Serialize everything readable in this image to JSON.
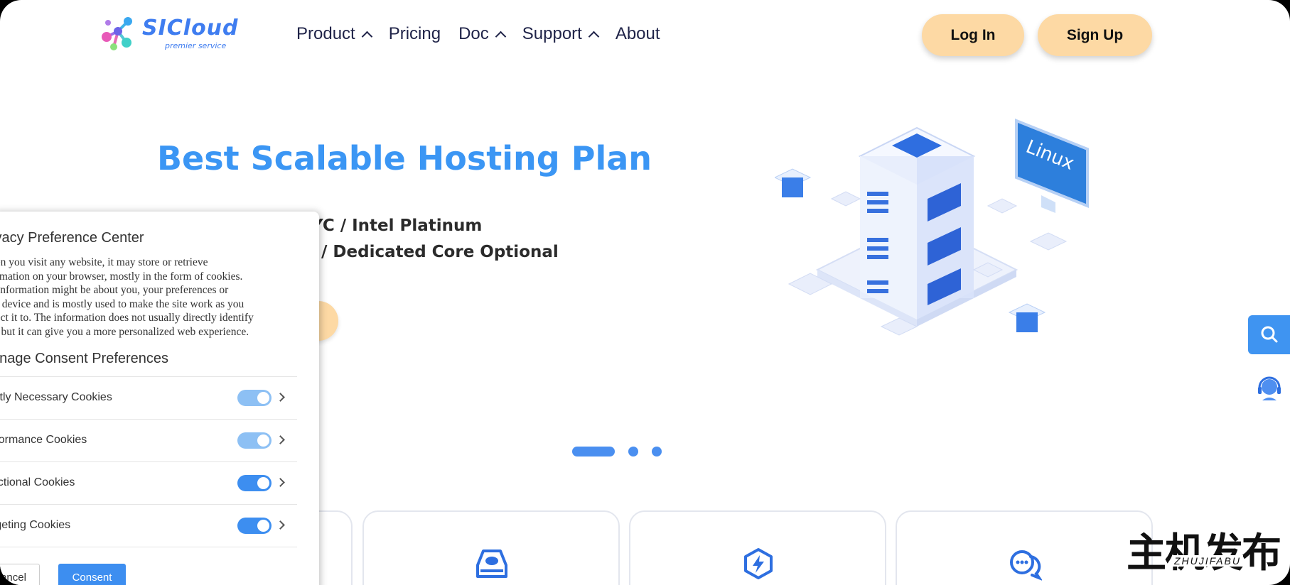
{
  "header": {
    "logo_text": "SICloud",
    "logo_sub": "premier service",
    "nav": [
      {
        "label": "Product",
        "has_menu": true
      },
      {
        "label": "Pricing",
        "has_menu": false
      },
      {
        "label": "Doc",
        "has_menu": true
      },
      {
        "label": "Support",
        "has_menu": true
      },
      {
        "label": "About",
        "has_menu": false
      }
    ],
    "login_label": "Log In",
    "signup_label": "Sign Up"
  },
  "hero": {
    "title": "Best Scalable Hosting Plan",
    "line1": "YC / Intel Platinum",
    "line2": "/ Dedicated Core Optional",
    "art_label": "Linux"
  },
  "carousel": {
    "total": 3,
    "active": 1
  },
  "cookie_panel": {
    "title": "ivacy Preference Center",
    "body_lines": [
      "hen you visit any website, it may store or retrieve",
      "ormation on your browser, mostly in the form of cookies.",
      "s information might be about you, your preferences or",
      "ur device and is mostly used to make the site work as you",
      "pect it to. The information does not usually directly identify",
      "u, but it can give you a more personalized web experience."
    ],
    "manage_title": "anage Consent Preferences",
    "categories": [
      {
        "label": "ictly Necessary Cookies",
        "enabled": true,
        "locked": true
      },
      {
        "label": "rformance Cookies",
        "enabled": true,
        "locked": true
      },
      {
        "label": "nctional Cookies",
        "enabled": true,
        "locked": false
      },
      {
        "label": "rgeting Cookies",
        "enabled": true,
        "locked": false
      }
    ],
    "cancel_label": "ancel",
    "consent_label": "Consent"
  },
  "watermark": {
    "cn": "主机发布",
    "en": "ZHUJIFABU"
  },
  "colors": {
    "accent": "#3b96f4",
    "button_peach": "#fdd9a4",
    "toggle_on": "#3d8ef0",
    "toggle_locked": "#8dc0f4"
  }
}
